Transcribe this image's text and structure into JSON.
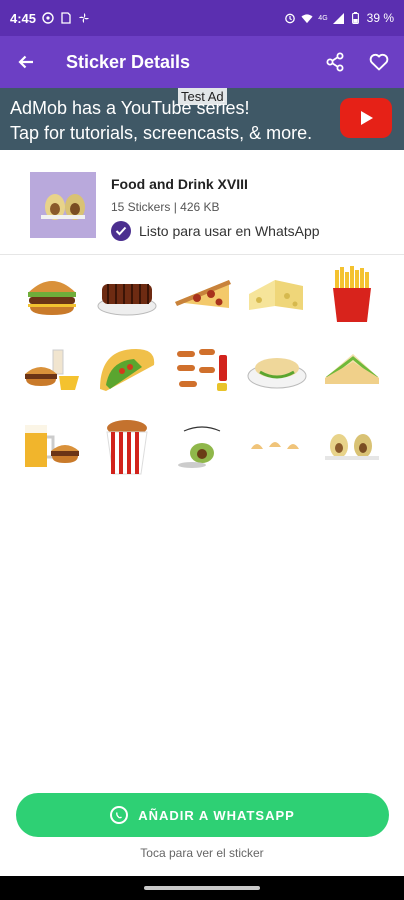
{
  "status_bar": {
    "time": "4:45",
    "battery": "39 %",
    "network": "4G"
  },
  "app_bar": {
    "title": "Sticker Details"
  },
  "ad": {
    "label": "Test Ad",
    "line1": "AdMob has a YouTube series!",
    "line2": "Tap for tutorials, screencasts, & more."
  },
  "pack": {
    "name": "Food and Drink XVIII",
    "meta": "15 Stickers | 426 KB",
    "ready_text": "Listo para usar en WhatsApp"
  },
  "stickers": [
    "burger",
    "ribs",
    "pizza-slice",
    "cheese",
    "french-fries",
    "burger-combo",
    "taco",
    "hotdogs",
    "burrito-plate",
    "sandwich",
    "beer-and-burger",
    "fried-chicken-bucket",
    "avocado-text",
    "small-dumplings",
    "avocado-characters"
  ],
  "colors": {
    "status_bar": "#5b2fb0",
    "app_bar": "#6c3fc4",
    "accent_green": "#2ed074",
    "check_purple": "#4b2f8f"
  },
  "actions": {
    "add_label": "AÑADIR A WHATSAPP",
    "hint": "Toca para ver el sticker"
  }
}
